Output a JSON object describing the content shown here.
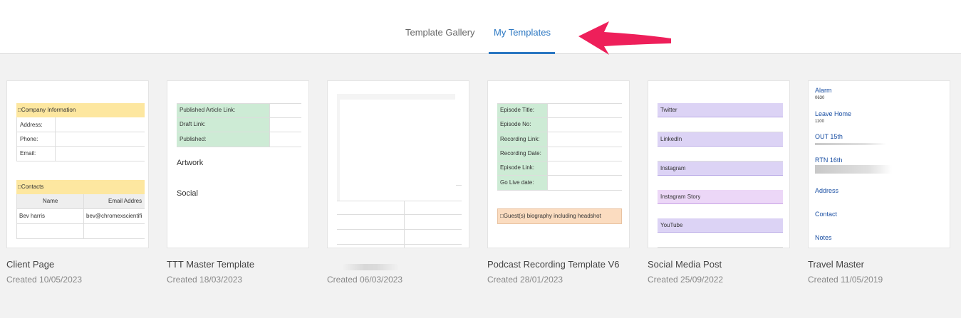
{
  "tabs": {
    "gallery_label": "Template Gallery",
    "mine_label": "My Templates",
    "active": "My Templates"
  },
  "colors": {
    "accent": "#2b77c2",
    "arrow": "#ee1f5a",
    "yellow_header": "#fde7a0",
    "green_cell": "#cdebd5",
    "purple_row": "#dcd3f5",
    "orange_row": "#fbdcc0"
  },
  "templates": [
    {
      "name": "Client Page",
      "created": "Created 10/05/2023",
      "preview": {
        "company_header": "□Company Information",
        "company_fields": [
          "Address:",
          "Phone:",
          "Email:"
        ],
        "contacts_header": "□Contacts",
        "contacts_columns": [
          "Name",
          "Email Address"
        ],
        "contacts_rows": [
          [
            "Bev harris",
            "bev@chromexscientific"
          ]
        ]
      }
    },
    {
      "name": "TTT Master Template",
      "created": "Created 18/03/2023",
      "preview": {
        "fields": [
          "Published Article Link:",
          "Draft Link:",
          "Published:"
        ],
        "sections": [
          "Artwork",
          "Social"
        ]
      }
    },
    {
      "name": "",
      "created": "Created 06/03/2023",
      "preview": {}
    },
    {
      "name": "Podcast Recording Template V6",
      "created": "Created 28/01/2023",
      "preview": {
        "fields": [
          "Episode Title:",
          "Episode No:",
          "Recording Link:",
          "Recording Date:",
          "Episode Link:",
          "Go Live date:"
        ],
        "bio_label": "□Guest(s) biography including headshot"
      }
    },
    {
      "name": "Social Media Post",
      "created": "Created 25/09/2022",
      "preview": {
        "rows": [
          "Twitter",
          "LinkedIn",
          "Instagram",
          "Instagram Story",
          "YouTube"
        ]
      }
    },
    {
      "name": "Travel Master",
      "created": "Created 11/05/2019",
      "preview": {
        "alarm_label": "Alarm",
        "alarm_value": "0630",
        "leave_label": "Leave Home",
        "leave_value": "1100",
        "out_label": "OUT 15th",
        "rtn_label": "RTN 16th",
        "address_label": "Address",
        "contact_label": "Contact",
        "notes_label": "Notes"
      }
    }
  ]
}
